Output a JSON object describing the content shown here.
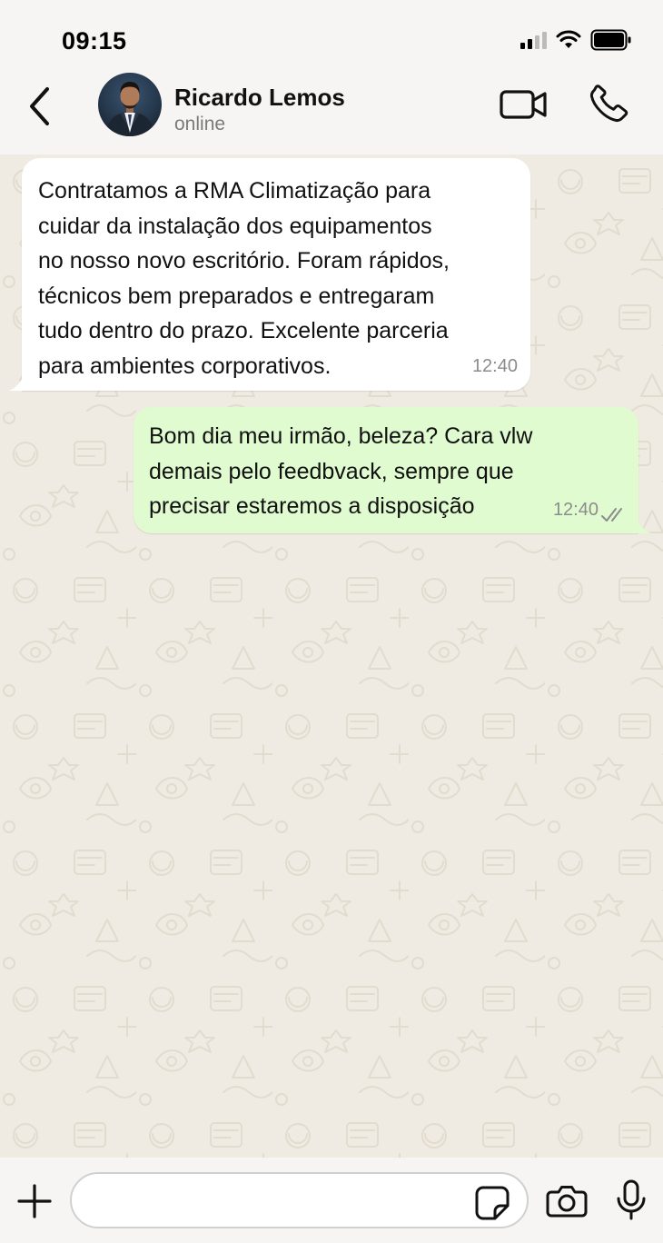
{
  "status_bar": {
    "time": "09:15",
    "icons": [
      "signal-icon",
      "wifi-icon",
      "battery-icon"
    ]
  },
  "header": {
    "back_icon": "chevron-left-icon",
    "contact_name": "Ricardo Lemos",
    "contact_status": "online",
    "video_icon": "video-camera-icon",
    "call_icon": "phone-icon"
  },
  "messages": [
    {
      "direction": "incoming",
      "lines": [
        "Contratamos a RMA Climatização para",
        "cuidar da instalação dos equipamentos",
        "no nosso novo escritório. Foram rápidos,",
        "técnicos bem preparados e entregaram",
        "tudo dentro do prazo. Excelente parceria",
        "para ambientes corporativos."
      ],
      "time": "12:40"
    },
    {
      "direction": "outgoing",
      "lines": [
        "Bom dia meu irmão, beleza? Cara vlw",
        "demais pelo feedbvack, sempre que",
        "precisar estaremos a disposição"
      ],
      "time": "12:40",
      "status_icon": "double-check-icon"
    }
  ],
  "input_bar": {
    "placeholder": "",
    "value": "",
    "icons": [
      "plus-icon",
      "sticker-icon",
      "camera-icon",
      "microphone-icon"
    ]
  },
  "colors": {
    "incoming_bubble": "#ffffff",
    "outgoing_bubble": "#e0fbd0",
    "chat_background": "#efeae2",
    "bar_background": "#f6f5f3"
  }
}
